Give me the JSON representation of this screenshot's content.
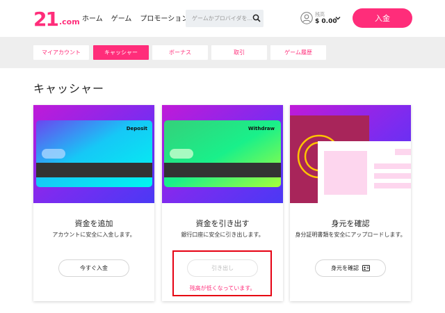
{
  "header": {
    "logo_number": "21",
    "logo_suffix": ".com",
    "nav": [
      "ホーム",
      "ゲーム",
      "プロモーション"
    ],
    "search_placeholder": "ゲームかプロバイダを...",
    "balance_label": "残高",
    "balance_value": "$ 0.00",
    "deposit_label": "入金"
  },
  "tabs": [
    "マイアカウント",
    "キャッシャー",
    "ボーナス",
    "取引",
    "ゲーム履歴"
  ],
  "active_tab": 1,
  "page_title": "キャッシャー",
  "cards": [
    {
      "card_label": "Deposit",
      "title": "資金を追加",
      "desc": "アカウントに安全に入金します。",
      "button": "今すぐ入金"
    },
    {
      "card_label": "Withdraw",
      "title": "資金を引き出す",
      "desc": "銀行口座に安全に引き出します。",
      "button": "引き出し",
      "warning": "残高が低くなっています。"
    },
    {
      "title": "身元を確認",
      "desc": "身分証明書類を安全にアップロードします。",
      "button": "身元を確認"
    }
  ],
  "colors": {
    "brand": "#ff2d7a",
    "highlight_box": "#e60012"
  }
}
